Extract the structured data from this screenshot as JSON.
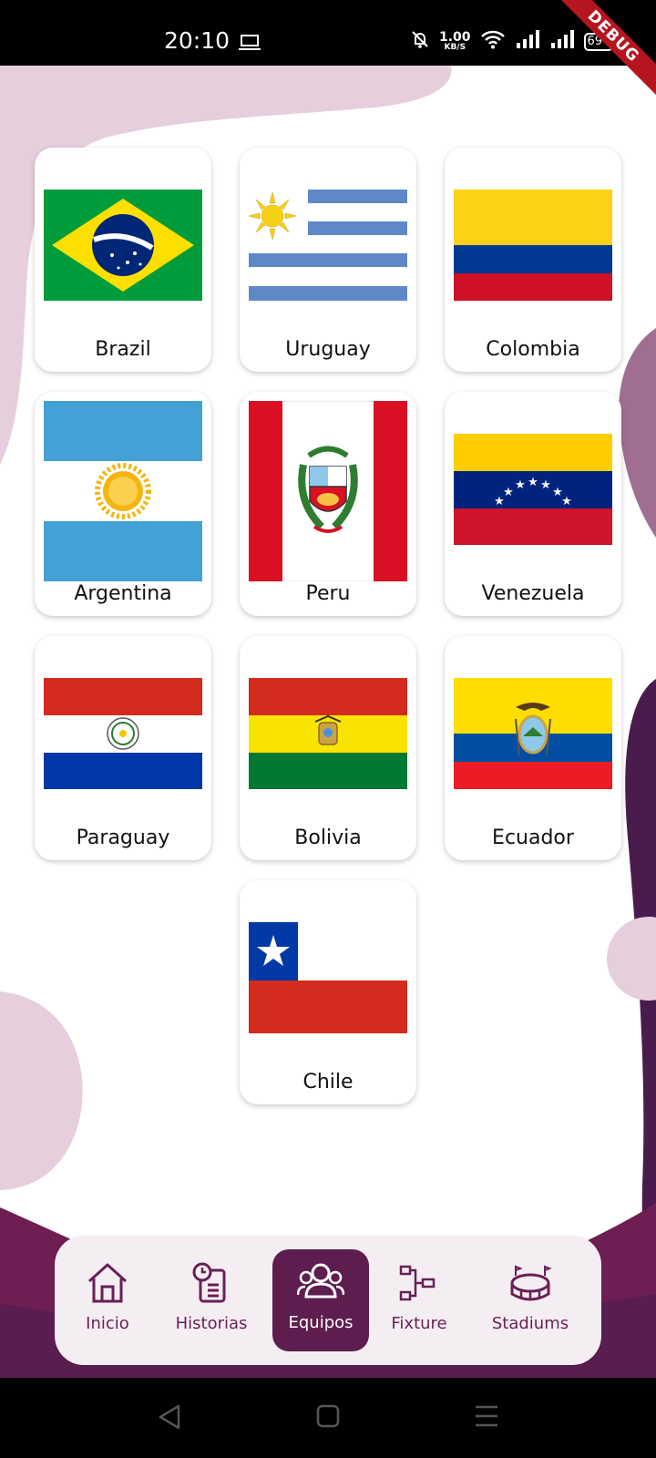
{
  "status_bar": {
    "time": "20:10",
    "net_speed": "1.00",
    "net_unit": "KB/S",
    "battery": "69",
    "debug_label": "DEBUG"
  },
  "colors": {
    "accent": "#5e1d4f",
    "nav_bg": "#f4eef3",
    "blob_light": "#e6cfdd"
  },
  "teams": [
    {
      "name": "Brazil"
    },
    {
      "name": "Uruguay"
    },
    {
      "name": "Colombia"
    },
    {
      "name": "Argentina"
    },
    {
      "name": "Peru"
    },
    {
      "name": "Venezuela"
    },
    {
      "name": "Paraguay"
    },
    {
      "name": "Bolivia"
    },
    {
      "name": "Ecuador"
    },
    {
      "name": "Chile"
    }
  ],
  "nav": {
    "items": [
      {
        "label": "Inicio",
        "icon": "home-icon"
      },
      {
        "label": "Historias",
        "icon": "history-icon"
      },
      {
        "label": "Equipos",
        "icon": "group-icon",
        "active": true
      },
      {
        "label": "Fixture",
        "icon": "bracket-icon"
      },
      {
        "label": "Stadiums",
        "icon": "stadium-icon"
      }
    ]
  },
  "system_nav": {
    "items": [
      {
        "icon": "back-icon"
      },
      {
        "icon": "home-square-icon"
      },
      {
        "icon": "menu-icon"
      }
    ]
  }
}
